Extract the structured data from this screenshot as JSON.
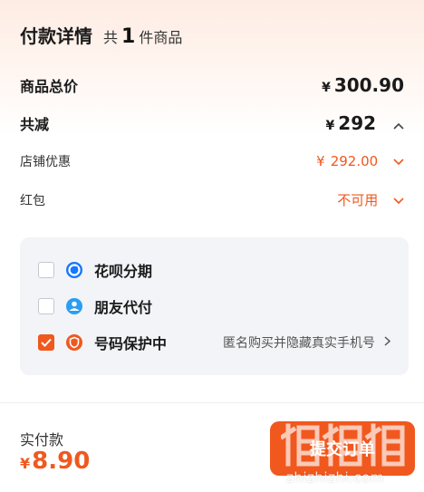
{
  "header": {
    "title": "付款详情",
    "count_prefix": "共",
    "count": "1",
    "count_suffix": "件商品"
  },
  "summary": {
    "goods_total_label": "商品总价",
    "goods_total_currency": "¥",
    "goods_total_value": "300.90",
    "discount_label": "共减",
    "discount_currency": "¥",
    "discount_value": "292",
    "store_discount_label": "店铺优惠",
    "store_discount_currency": "¥",
    "store_discount_value": "292.00",
    "red_packet_label": "红包",
    "red_packet_value": "不可用"
  },
  "options": [
    {
      "label": "花呗分期",
      "checked": false,
      "icon": "huabei-icon"
    },
    {
      "label": "朋友代付",
      "checked": false,
      "icon": "friend-pay-icon"
    },
    {
      "label": "号码保护中",
      "checked": true,
      "icon": "number-protect-icon",
      "note": "匿名购买并隐藏真实手机号"
    }
  ],
  "footer": {
    "pay_label": "实付款",
    "pay_currency": "¥",
    "pay_value": "8.90",
    "submit_label": "提交订单"
  },
  "watermark": {
    "text": "zhizhizhi.com"
  },
  "colors": {
    "accent": "#f0581e",
    "panel_bg": "#f2f4f7"
  }
}
